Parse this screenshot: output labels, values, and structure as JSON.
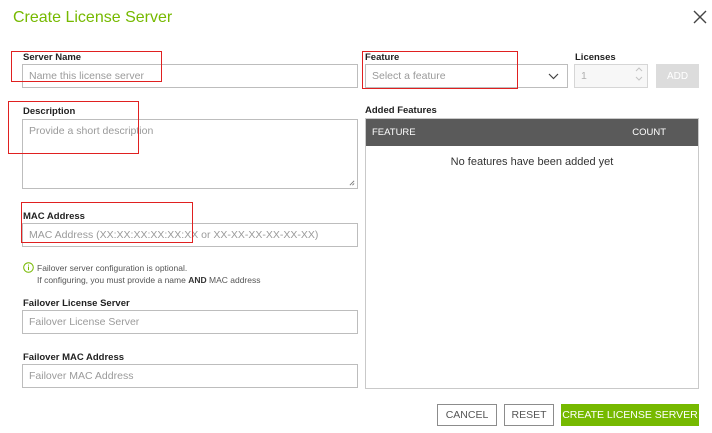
{
  "dialog": {
    "title": "Create License Server"
  },
  "form": {
    "server_name": {
      "label": "Server Name",
      "placeholder": "Name this license server"
    },
    "description": {
      "label": "Description",
      "placeholder": "Provide a short description"
    },
    "mac_address": {
      "label": "MAC Address",
      "placeholder": "MAC Address (XX:XX:XX:XX:XX:XX or XX-XX-XX-XX-XX-XX)"
    },
    "feature": {
      "label": "Feature",
      "selected": "Select a feature"
    },
    "licenses": {
      "label": "Licenses",
      "value": "1"
    },
    "add_label": "ADD",
    "info": {
      "line1": "Failover server configuration is optional.",
      "line2_prefix": "If configuring, you must provide a name ",
      "line2_bold": "AND",
      "line2_suffix": " MAC address"
    },
    "failover_server": {
      "label": "Failover License Server",
      "placeholder": "Failover License Server"
    },
    "failover_mac": {
      "label": "Failover MAC Address",
      "placeholder": "Failover MAC Address"
    }
  },
  "added_features": {
    "label": "Added Features",
    "columns": [
      "FEATURE",
      "COUNT"
    ],
    "empty_text": "No features have been added yet"
  },
  "actions": {
    "cancel": "CANCEL",
    "reset": "RESET",
    "create": "CREATE LICENSE SERVER"
  },
  "colors": {
    "accent": "#76b900",
    "table_header": "#5a5a5a",
    "highlight": "#e02020"
  }
}
